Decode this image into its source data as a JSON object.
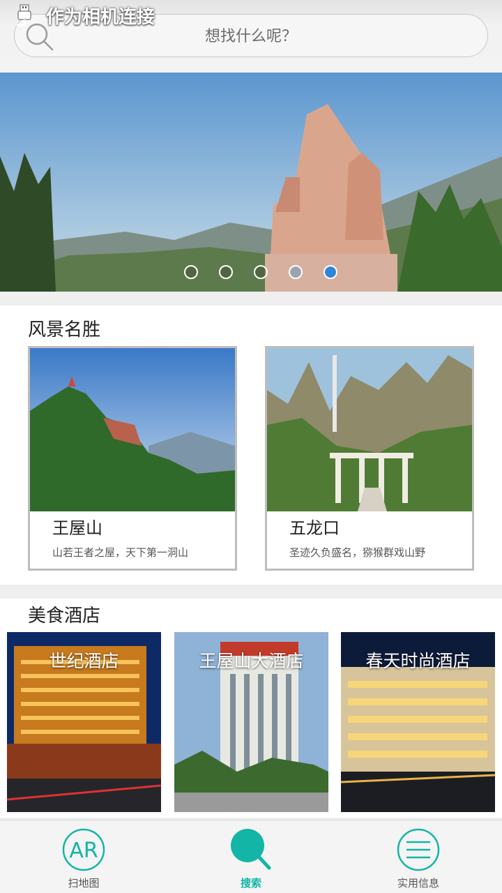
{
  "notification": {
    "text": "作为相机连接",
    "icon": "usb-icon"
  },
  "search": {
    "placeholder": "想找什么呢？",
    "icon": "search-icon"
  },
  "banner": {
    "dots": 5,
    "active_index": 4
  },
  "scenic": {
    "title": "风景名胜",
    "items": [
      {
        "name": "王屋山",
        "desc": "山若王者之屋，天下第一洞山"
      },
      {
        "name": "五龙口",
        "desc": "圣迹久负盛名，猕猴群戏山野"
      }
    ]
  },
  "food": {
    "title": "美食酒店",
    "items": [
      {
        "name": "世纪酒店"
      },
      {
        "name": "王屋山大酒店"
      },
      {
        "name": "春天时尚酒店"
      }
    ]
  },
  "nav": {
    "items": [
      {
        "label": "扫地图",
        "icon": "ar-icon"
      },
      {
        "label": "搜索",
        "icon": "search-icon"
      },
      {
        "label": "实用信息",
        "icon": "menu-icon"
      }
    ],
    "active": "搜索",
    "accent": "#12b5a6"
  }
}
